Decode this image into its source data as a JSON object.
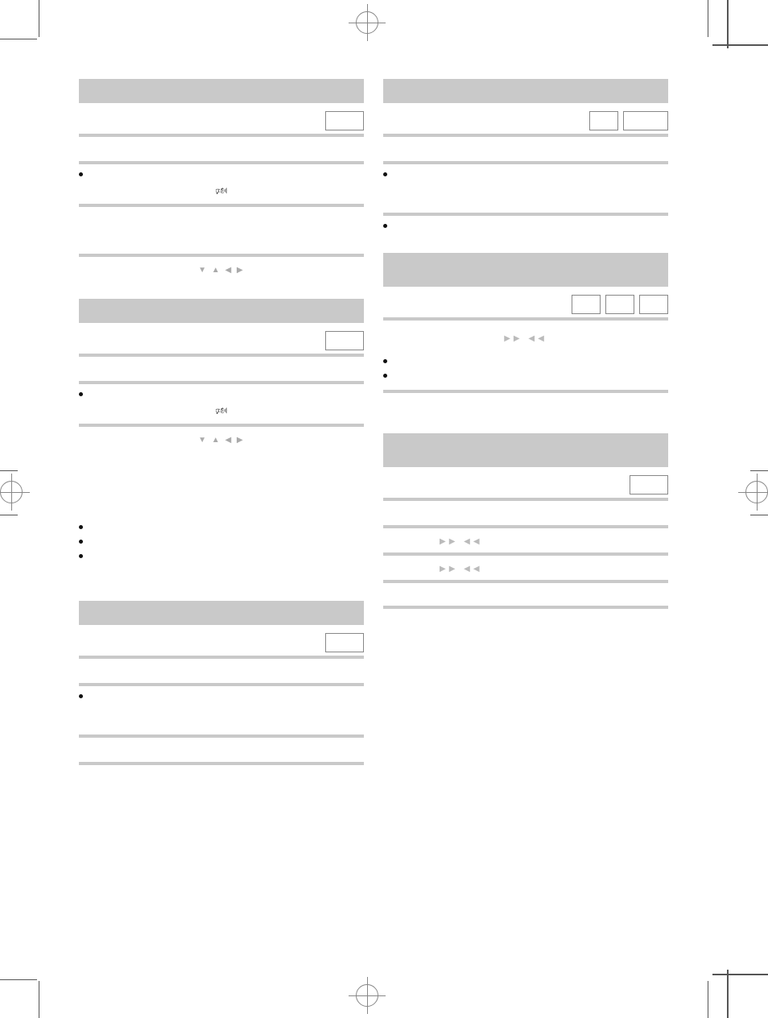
{
  "left": {
    "sections": [
      {
        "id": "s1",
        "steps": [
          {
            "type": "img-right",
            "imgCount": 1
          },
          {
            "type": "blank"
          },
          {
            "type": "bullet"
          },
          {
            "type": "icon-speaker-hr"
          },
          {
            "type": "blank-tall"
          },
          {
            "type": "arrows-udlr"
          }
        ]
      },
      {
        "id": "s2",
        "steps": [
          {
            "type": "img-right",
            "imgCount": 1
          },
          {
            "type": "blank"
          },
          {
            "type": "bullet"
          },
          {
            "type": "icon-speaker-hr"
          },
          {
            "type": "arrows-udlr"
          }
        ],
        "postBullets": 3
      },
      {
        "id": "s3",
        "steps": [
          {
            "type": "img-right",
            "imgCount": 1
          },
          {
            "type": "blank"
          },
          {
            "type": "bullet"
          },
          {
            "type": "blank-tall"
          },
          {
            "type": "blank"
          }
        ]
      }
    ]
  },
  "right": {
    "sections": [
      {
        "id": "r1",
        "steps": [
          {
            "type": "img-right",
            "imgCount": 2
          },
          {
            "type": "blank"
          },
          {
            "type": "bullet"
          },
          {
            "type": "blank-short"
          },
          {
            "type": "bullet-nohr"
          }
        ]
      },
      {
        "id": "r2",
        "steps": [
          {
            "type": "img-right",
            "imgCount": 3
          },
          {
            "type": "ff-rw-row"
          }
        ],
        "postBullets": 2
      },
      {
        "id": "r3",
        "steps": [
          {
            "type": "img-right",
            "imgCount": 1
          },
          {
            "type": "blank"
          },
          {
            "type": "ff-rw-row"
          },
          {
            "type": "ff-rw-row"
          }
        ],
        "extraHrBelow": true
      }
    ]
  },
  "icons": {
    "speaker": "🕬",
    "arrowsUDLR": "▼ ▲ ◀ ▶",
    "ffRw": "▶▶   ◀◀"
  }
}
